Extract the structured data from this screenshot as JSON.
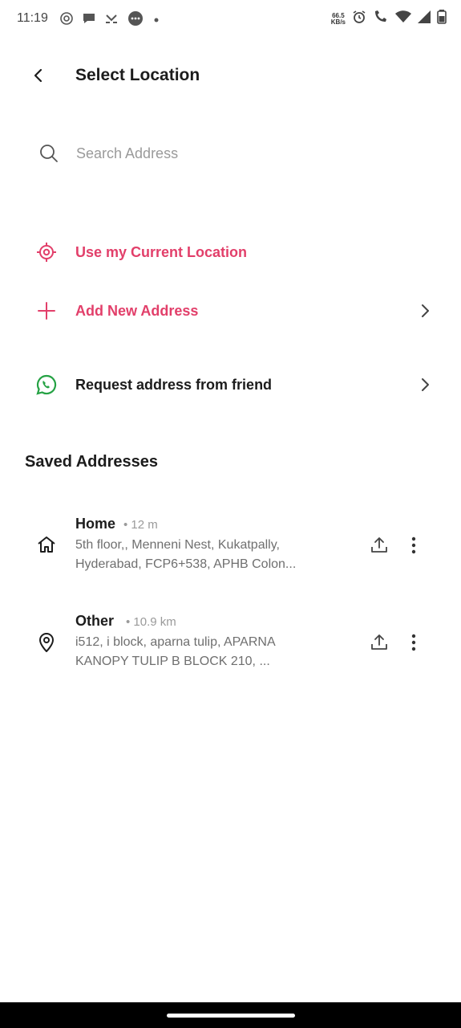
{
  "status_bar": {
    "time": "11:19",
    "net_speed_top": "66.5",
    "net_speed_bottom": "KB/s",
    "left_icons": [
      "radio-icon",
      "chat-bubble-icon",
      "missed-call-icon",
      "messages-icon",
      "dot-icon"
    ],
    "right_icons": [
      "alarm-icon",
      "wifi-calling-icon",
      "wifi-icon",
      "signal-icon",
      "battery-icon"
    ]
  },
  "header": {
    "title": "Select Location",
    "back_icon": "chevron-left-icon"
  },
  "search": {
    "placeholder": "Search Address",
    "icon": "search-icon"
  },
  "actions": [
    {
      "label": "Use my Current Location",
      "icon": "crosshair-icon",
      "chevron": false,
      "color": "#e23f6a"
    },
    {
      "label": "Add New Address",
      "icon": "plus-icon",
      "chevron": true,
      "color": "#e23f6a"
    },
    {
      "label": "Request address from friend",
      "icon": "whatsapp-icon",
      "chevron": true,
      "color": "#1c1c1c"
    }
  ],
  "saved": {
    "title": "Saved Addresses",
    "items": [
      {
        "name": "Home",
        "distance": "• 12 m",
        "line1": "5th floor,, Menneni Nest, Kukatpally,",
        "line2": "Hyderabad, FCP6+538, APHB Colon...",
        "icon": "home-icon"
      },
      {
        "name": "Other",
        "distance": "• 10.9 km",
        "line1": "i512, i block, aparna tulip, APARNA",
        "line2": "KANOPY TULIP B BLOCK 210, ...",
        "icon": "location-pin-icon"
      }
    ]
  },
  "colors": {
    "accent": "#e23f6a",
    "whatsapp": "#25a244",
    "text": "#1c1c1c",
    "muted": "#6f6f6f"
  }
}
